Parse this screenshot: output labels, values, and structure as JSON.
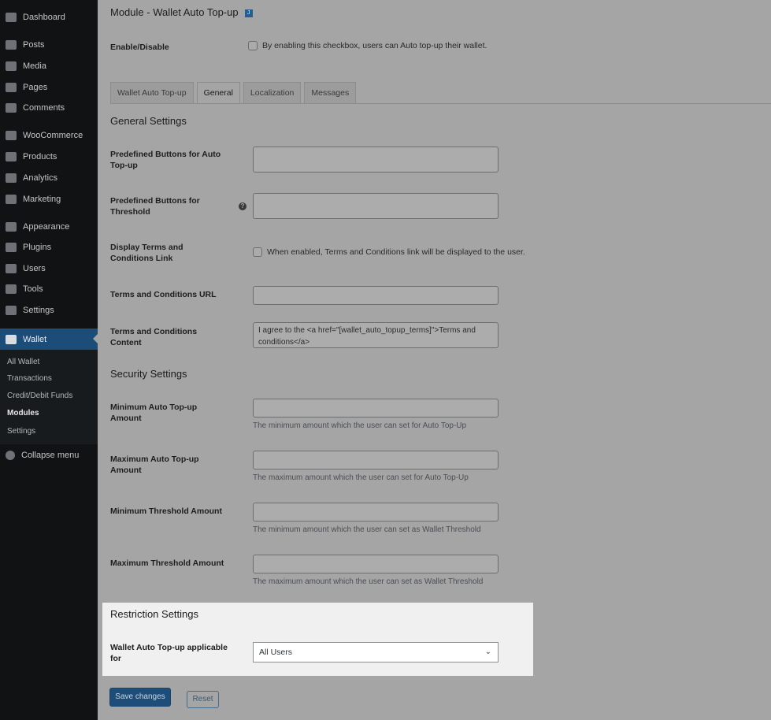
{
  "sidebar": {
    "items": [
      "Dashboard",
      "Posts",
      "Media",
      "Pages",
      "Comments",
      "WooCommerce",
      "Products",
      "Analytics",
      "Marketing",
      "Appearance",
      "Plugins",
      "Users",
      "Tools",
      "Settings",
      "Wallet"
    ],
    "submenu": [
      "All Wallet",
      "Transactions",
      "Credit/Debit Funds",
      "Modules",
      "Settings"
    ],
    "collapse": "Collapse menu"
  },
  "page": {
    "title": "Module - Wallet Auto Top-up",
    "badge": "J",
    "enable_label": "Enable/Disable",
    "enable_desc": "By enabling this checkbox, users can Auto top-up their wallet."
  },
  "tabs": [
    "Wallet Auto Top-up",
    "General",
    "Localization",
    "Messages"
  ],
  "general": {
    "heading": "General Settings",
    "predef_auto": "Predefined Buttons for Auto Top-up",
    "predef_threshold": "Predefined Buttons for Threshold",
    "help_icon": "?",
    "display_terms": "Display Terms and Conditions Link",
    "display_terms_desc": "When enabled, Terms and Conditions link will be displayed to the user.",
    "terms_url": "Terms and Conditions URL",
    "terms_content": "Terms and Conditions Content",
    "terms_content_value": "I agree to the <a href=\"[wallet_auto_topup_terms]\">Terms and conditions</a>"
  },
  "security": {
    "heading": "Security Settings",
    "rows": [
      {
        "label": "Minimum Auto Top-up Amount",
        "desc": "The minimum amount which the user can set for Auto Top-Up"
      },
      {
        "label": "Maximum Auto Top-up Amount",
        "desc": "The maximum amount which the user can set for Auto Top-Up"
      },
      {
        "label": "Minimum Threshold Amount",
        "desc": "The minimum amount which the user can set as Wallet Threshold"
      },
      {
        "label": "Maximum Threshold Amount",
        "desc": "The maximum amount which the user can set as Wallet Threshold"
      }
    ]
  },
  "restriction": {
    "heading": "Restriction Settings",
    "label": "Wallet Auto Top-up applicable for",
    "value": "All Users"
  },
  "actions": {
    "save": "Save changes",
    "reset": "Reset"
  }
}
